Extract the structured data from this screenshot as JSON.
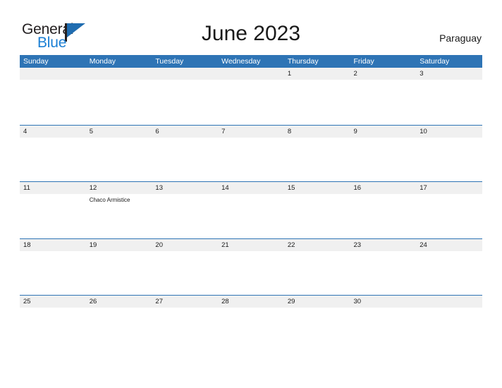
{
  "brand": {
    "name_part1": "General",
    "name_part2": "Blue",
    "flag_icon": "flag-triangle-icon",
    "accent_color": "#1f6cb0"
  },
  "header": {
    "title": "June 2023",
    "country": "Paraguay"
  },
  "colors": {
    "header_blue": "#2e74b5",
    "row_stripe": "#f0f0f0",
    "separator": "#2e74b5",
    "text": "#1a1a1a",
    "page_background": "#ffffff"
  },
  "calendar": {
    "weekdays": [
      "Sunday",
      "Monday",
      "Tuesday",
      "Wednesday",
      "Thursday",
      "Friday",
      "Saturday"
    ],
    "weeks": [
      [
        {
          "date": "",
          "events": []
        },
        {
          "date": "",
          "events": []
        },
        {
          "date": "",
          "events": []
        },
        {
          "date": "",
          "events": []
        },
        {
          "date": "1",
          "events": []
        },
        {
          "date": "2",
          "events": []
        },
        {
          "date": "3",
          "events": []
        }
      ],
      [
        {
          "date": "4",
          "events": []
        },
        {
          "date": "5",
          "events": []
        },
        {
          "date": "6",
          "events": []
        },
        {
          "date": "7",
          "events": []
        },
        {
          "date": "8",
          "events": []
        },
        {
          "date": "9",
          "events": []
        },
        {
          "date": "10",
          "events": []
        }
      ],
      [
        {
          "date": "11",
          "events": []
        },
        {
          "date": "12",
          "events": [
            "Chaco Armistice"
          ]
        },
        {
          "date": "13",
          "events": []
        },
        {
          "date": "14",
          "events": []
        },
        {
          "date": "15",
          "events": []
        },
        {
          "date": "16",
          "events": []
        },
        {
          "date": "17",
          "events": []
        }
      ],
      [
        {
          "date": "18",
          "events": []
        },
        {
          "date": "19",
          "events": []
        },
        {
          "date": "20",
          "events": []
        },
        {
          "date": "21",
          "events": []
        },
        {
          "date": "22",
          "events": []
        },
        {
          "date": "23",
          "events": []
        },
        {
          "date": "24",
          "events": []
        }
      ],
      [
        {
          "date": "25",
          "events": []
        },
        {
          "date": "26",
          "events": []
        },
        {
          "date": "27",
          "events": []
        },
        {
          "date": "28",
          "events": []
        },
        {
          "date": "29",
          "events": []
        },
        {
          "date": "30",
          "events": []
        },
        {
          "date": "",
          "events": []
        }
      ]
    ]
  }
}
